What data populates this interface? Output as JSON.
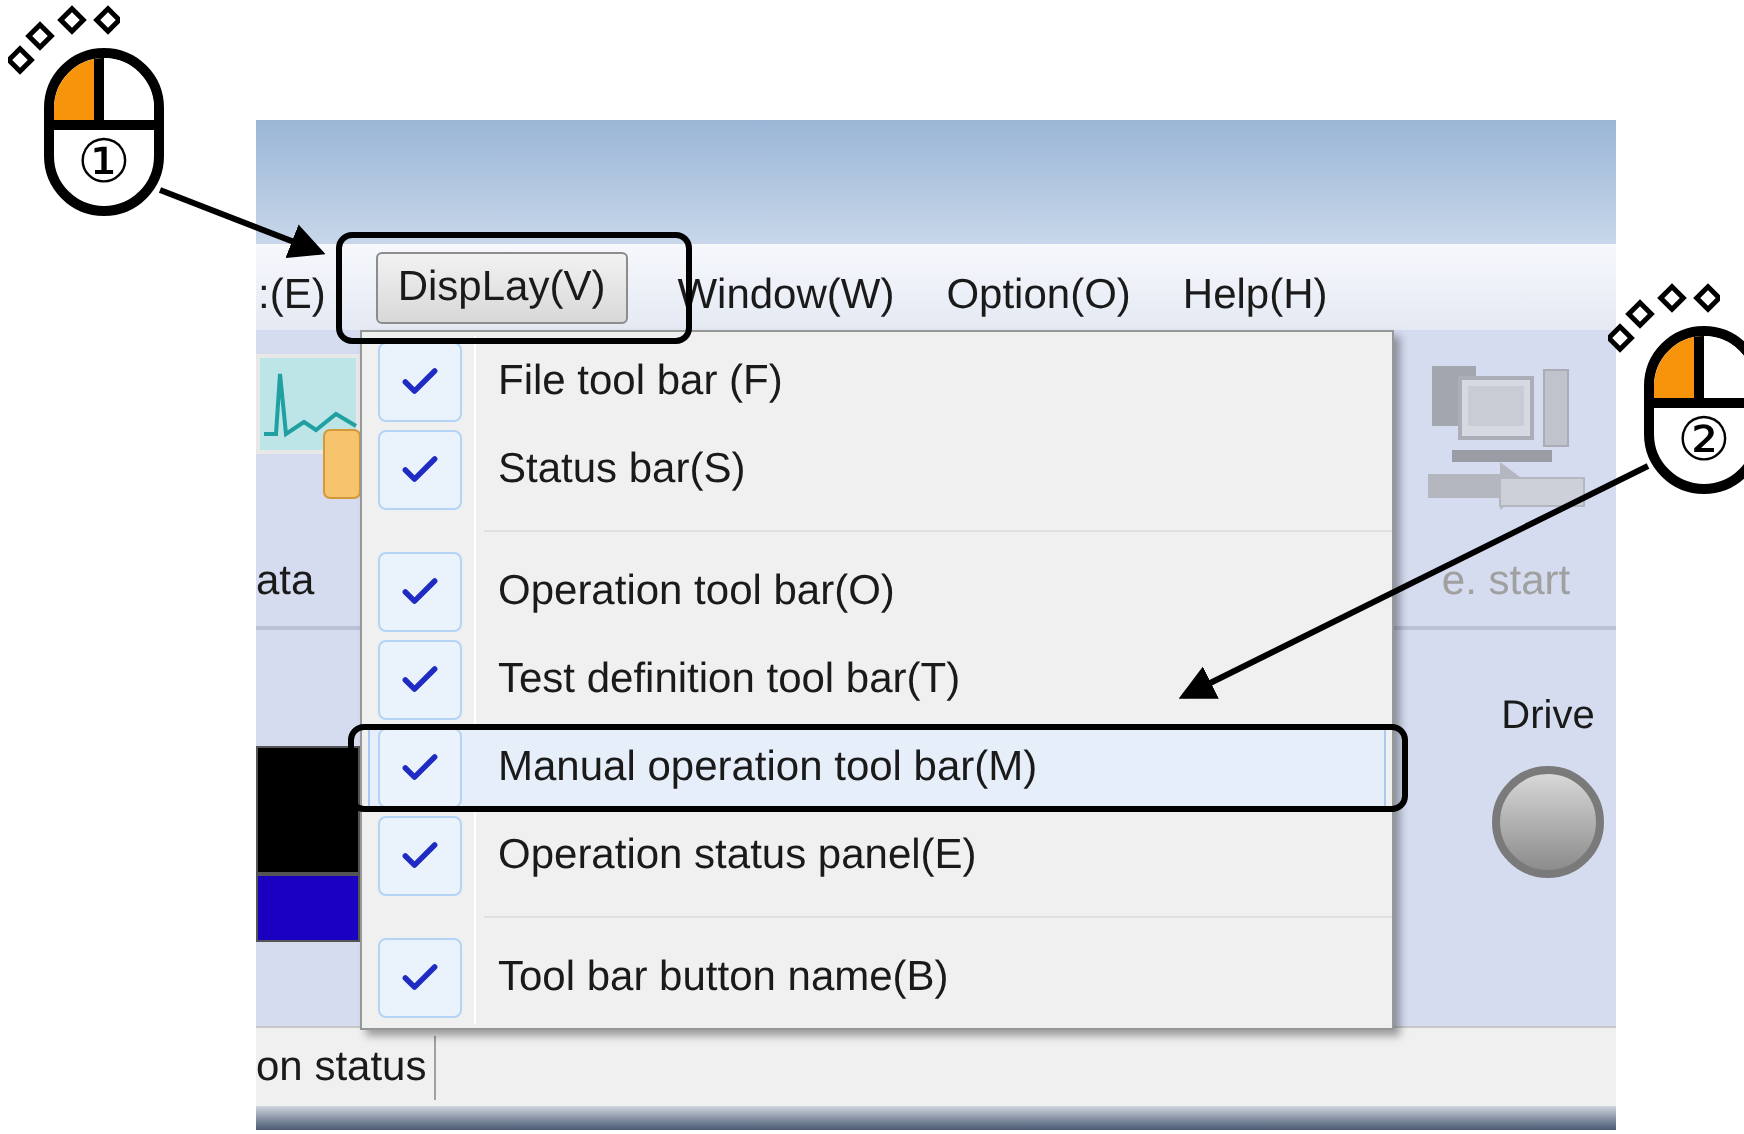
{
  "menu_bar": [
    {
      "label": ":(E)",
      "selected": false
    },
    {
      "label": "DispLay(V)",
      "selected": true
    },
    {
      "label": "Window(W)",
      "selected": false
    },
    {
      "label": "Option(O)",
      "selected": false
    },
    {
      "label": "Help(H)",
      "selected": false
    }
  ],
  "toolbar": {
    "buttons": [
      {
        "label": "ata",
        "disabled": false
      },
      {
        "label": "e. start",
        "disabled": true
      }
    ]
  },
  "panel": {
    "drive_label": "Drive"
  },
  "dropdown": {
    "groups": [
      [
        {
          "label": "File tool bar (F)",
          "checked": true,
          "selected": false
        },
        {
          "label": "Status bar(S)",
          "checked": true,
          "selected": false
        }
      ],
      [
        {
          "label": "Operation tool bar(O)",
          "checked": true,
          "selected": false
        },
        {
          "label": "Test definition tool bar(T)",
          "checked": true,
          "selected": false
        },
        {
          "label": "Manual operation tool bar(M)",
          "checked": true,
          "selected": true
        },
        {
          "label": "Operation status panel(E)",
          "checked": true,
          "selected": false
        }
      ],
      [
        {
          "label": "Tool bar button name(B)",
          "checked": true,
          "selected": false
        }
      ]
    ]
  },
  "status_bar": [
    "on status"
  ],
  "callouts": [
    {
      "number": "①"
    },
    {
      "number": "②"
    }
  ]
}
